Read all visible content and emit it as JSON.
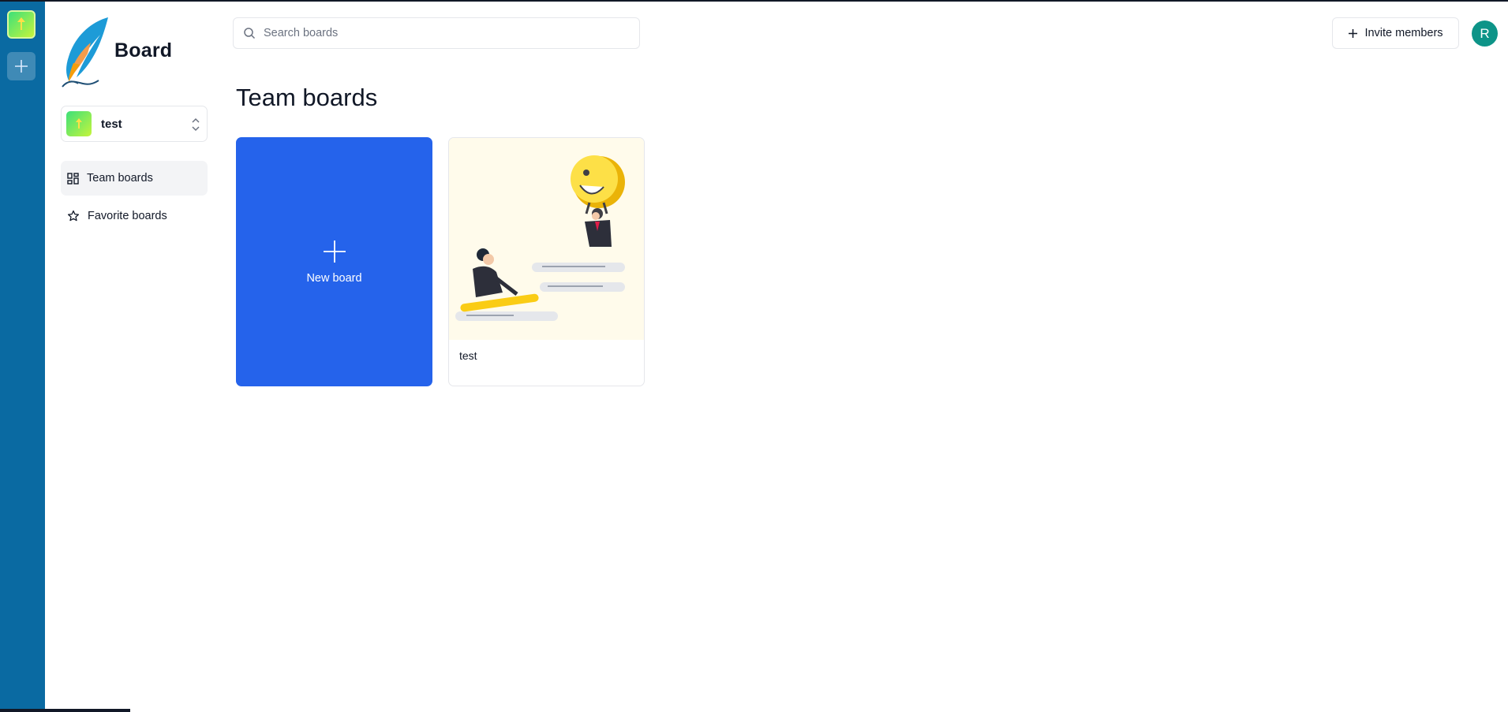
{
  "app": {
    "brand": "Board"
  },
  "org_rail": {
    "current_org_icon": "org-avatar-arrow",
    "add_icon": "plus-icon"
  },
  "org_switcher": {
    "name": "test",
    "icon": "chevrons-up-down-icon"
  },
  "nav": {
    "items": [
      {
        "label": "Team boards",
        "icon": "layout-dashboard-icon",
        "active": true
      },
      {
        "label": "Favorite boards",
        "icon": "star-icon",
        "active": false
      }
    ]
  },
  "search": {
    "placeholder": "Search boards",
    "value": ""
  },
  "header": {
    "invite_label": "Invite members",
    "avatar_initial": "R"
  },
  "main": {
    "title": "Team boards",
    "new_board_label": "New board",
    "boards": [
      {
        "title": "test"
      }
    ]
  },
  "colors": {
    "rail": "#0a6aa2",
    "new_board": "#2563eb",
    "avatar": "#0d9488",
    "thumb_bg": "#fffbeb"
  }
}
